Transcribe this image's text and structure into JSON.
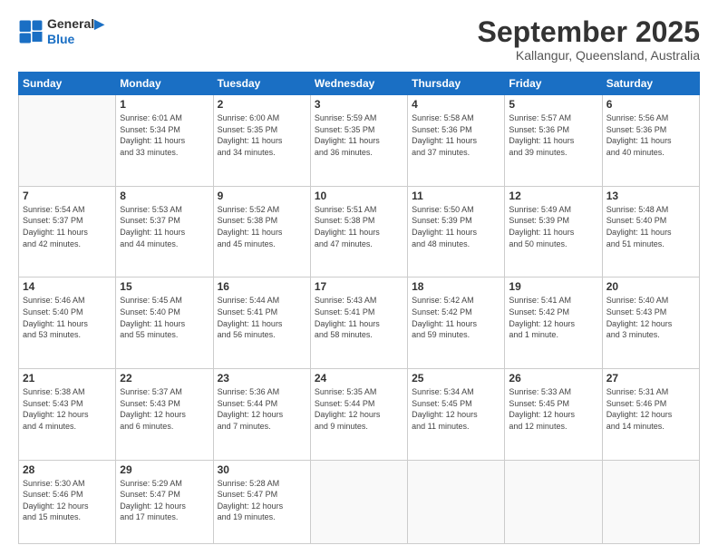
{
  "header": {
    "logo_line1": "General",
    "logo_line2": "Blue",
    "month": "September 2025",
    "location": "Kallangur, Queensland, Australia"
  },
  "weekdays": [
    "Sunday",
    "Monday",
    "Tuesday",
    "Wednesday",
    "Thursday",
    "Friday",
    "Saturday"
  ],
  "weeks": [
    [
      {
        "day": "",
        "info": ""
      },
      {
        "day": "1",
        "info": "Sunrise: 6:01 AM\nSunset: 5:34 PM\nDaylight: 11 hours\nand 33 minutes."
      },
      {
        "day": "2",
        "info": "Sunrise: 6:00 AM\nSunset: 5:35 PM\nDaylight: 11 hours\nand 34 minutes."
      },
      {
        "day": "3",
        "info": "Sunrise: 5:59 AM\nSunset: 5:35 PM\nDaylight: 11 hours\nand 36 minutes."
      },
      {
        "day": "4",
        "info": "Sunrise: 5:58 AM\nSunset: 5:36 PM\nDaylight: 11 hours\nand 37 minutes."
      },
      {
        "day": "5",
        "info": "Sunrise: 5:57 AM\nSunset: 5:36 PM\nDaylight: 11 hours\nand 39 minutes."
      },
      {
        "day": "6",
        "info": "Sunrise: 5:56 AM\nSunset: 5:36 PM\nDaylight: 11 hours\nand 40 minutes."
      }
    ],
    [
      {
        "day": "7",
        "info": "Sunrise: 5:54 AM\nSunset: 5:37 PM\nDaylight: 11 hours\nand 42 minutes."
      },
      {
        "day": "8",
        "info": "Sunrise: 5:53 AM\nSunset: 5:37 PM\nDaylight: 11 hours\nand 44 minutes."
      },
      {
        "day": "9",
        "info": "Sunrise: 5:52 AM\nSunset: 5:38 PM\nDaylight: 11 hours\nand 45 minutes."
      },
      {
        "day": "10",
        "info": "Sunrise: 5:51 AM\nSunset: 5:38 PM\nDaylight: 11 hours\nand 47 minutes."
      },
      {
        "day": "11",
        "info": "Sunrise: 5:50 AM\nSunset: 5:39 PM\nDaylight: 11 hours\nand 48 minutes."
      },
      {
        "day": "12",
        "info": "Sunrise: 5:49 AM\nSunset: 5:39 PM\nDaylight: 11 hours\nand 50 minutes."
      },
      {
        "day": "13",
        "info": "Sunrise: 5:48 AM\nSunset: 5:40 PM\nDaylight: 11 hours\nand 51 minutes."
      }
    ],
    [
      {
        "day": "14",
        "info": "Sunrise: 5:46 AM\nSunset: 5:40 PM\nDaylight: 11 hours\nand 53 minutes."
      },
      {
        "day": "15",
        "info": "Sunrise: 5:45 AM\nSunset: 5:40 PM\nDaylight: 11 hours\nand 55 minutes."
      },
      {
        "day": "16",
        "info": "Sunrise: 5:44 AM\nSunset: 5:41 PM\nDaylight: 11 hours\nand 56 minutes."
      },
      {
        "day": "17",
        "info": "Sunrise: 5:43 AM\nSunset: 5:41 PM\nDaylight: 11 hours\nand 58 minutes."
      },
      {
        "day": "18",
        "info": "Sunrise: 5:42 AM\nSunset: 5:42 PM\nDaylight: 11 hours\nand 59 minutes."
      },
      {
        "day": "19",
        "info": "Sunrise: 5:41 AM\nSunset: 5:42 PM\nDaylight: 12 hours\nand 1 minute."
      },
      {
        "day": "20",
        "info": "Sunrise: 5:40 AM\nSunset: 5:43 PM\nDaylight: 12 hours\nand 3 minutes."
      }
    ],
    [
      {
        "day": "21",
        "info": "Sunrise: 5:38 AM\nSunset: 5:43 PM\nDaylight: 12 hours\nand 4 minutes."
      },
      {
        "day": "22",
        "info": "Sunrise: 5:37 AM\nSunset: 5:43 PM\nDaylight: 12 hours\nand 6 minutes."
      },
      {
        "day": "23",
        "info": "Sunrise: 5:36 AM\nSunset: 5:44 PM\nDaylight: 12 hours\nand 7 minutes."
      },
      {
        "day": "24",
        "info": "Sunrise: 5:35 AM\nSunset: 5:44 PM\nDaylight: 12 hours\nand 9 minutes."
      },
      {
        "day": "25",
        "info": "Sunrise: 5:34 AM\nSunset: 5:45 PM\nDaylight: 12 hours\nand 11 minutes."
      },
      {
        "day": "26",
        "info": "Sunrise: 5:33 AM\nSunset: 5:45 PM\nDaylight: 12 hours\nand 12 minutes."
      },
      {
        "day": "27",
        "info": "Sunrise: 5:31 AM\nSunset: 5:46 PM\nDaylight: 12 hours\nand 14 minutes."
      }
    ],
    [
      {
        "day": "28",
        "info": "Sunrise: 5:30 AM\nSunset: 5:46 PM\nDaylight: 12 hours\nand 15 minutes."
      },
      {
        "day": "29",
        "info": "Sunrise: 5:29 AM\nSunset: 5:47 PM\nDaylight: 12 hours\nand 17 minutes."
      },
      {
        "day": "30",
        "info": "Sunrise: 5:28 AM\nSunset: 5:47 PM\nDaylight: 12 hours\nand 19 minutes."
      },
      {
        "day": "",
        "info": ""
      },
      {
        "day": "",
        "info": ""
      },
      {
        "day": "",
        "info": ""
      },
      {
        "day": "",
        "info": ""
      }
    ]
  ]
}
